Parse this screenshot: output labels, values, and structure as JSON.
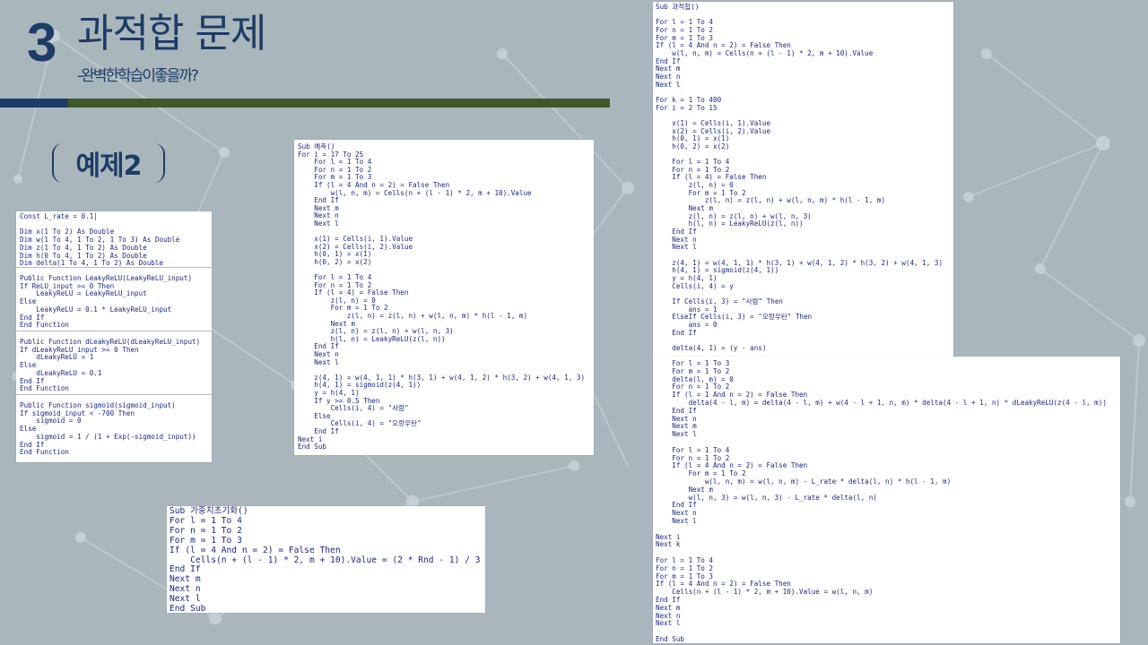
{
  "header": {
    "number": "3",
    "title": "과적합 문제",
    "subtitle": "-완벽한학습이좋을까?"
  },
  "example_label": "예제2",
  "colors": {
    "title_navy": "#1d3c66",
    "rule_green": "#3d5a2a",
    "code_text": "#1a2a7a",
    "background": "#a9b7bd"
  },
  "code": {
    "declarations": "Const L_rate = 0.1|\n\nDim x(1 To 2) As Double\nDim w(1 To 4, 1 To 2, 1 To 3) As Double\nDim z(1 To 4, 1 To 2) As Double\nDim h(0 To 4, 1 To 2) As Double\nDim delta(1 To 4, 1 To 2) As Double",
    "leaky_relu": "Public Function LeakyReLU(LeakyReLU_input)\nIf ReLU_input >= 0 Then\n    LeakyReLU = LeakyReLU_input\nElse\n    LeakyReLU = 0.1 * LeakyReLU_input\nEnd If\nEnd Function",
    "d_leaky_relu": "Public Function dLeakyReLU(dLeakyReLU_input)\nIf dLeakyReLU_input >= 0 Then\n    dLeakyReLU = 1\nElse\n    dLeakyReLU = 0.1\nEnd If\nEnd Function",
    "sigmoid": "Public Function sigmoid(sigmoid_input)\nIf sigmoid_input < -700 Then\n    sigmoid = 0\nElse\n    sigmoid = 1 / (1 + Exp(-sigmoid_input))\nEnd If\nEnd Function",
    "predict": "Sub 예측()\nFor i = 17 To 25\n    For l = 1 To 4\n    For n = 1 To 2\n    For m = 1 To 3\n    If (l = 4 And n = 2) = False Then\n        w(l, n, m) = Cells(n + (l - 1) * 2, m + 10).Value\n    End If\n    Next m\n    Next n\n    Next l\n\n    x(1) = Cells(i, 1).Value\n    x(2) = Cells(i, 2).Value\n    h(0, 1) = x(1)\n    h(0, 2) = x(2)\n\n    For l = 1 To 4\n    For n = 1 To 2\n    If (l = 4) = False Then\n        z(l, n) = 0\n        For m = 1 To 2\n            z(l, n) = z(l, n) + w(l, n, m) * h(l - 1, m)\n        Next m\n        z(l, n) = z(l, n) + w(l, n, 3)\n        h(l, n) = LeakyReLU(z(l, n))\n    End If\n    Next n\n    Next l\n\n    z(4, 1) = w(4, 1, 1) * h(3, 1) + w(4, 1, 2) * h(3, 2) + w(4, 1, 3)\n    h(4, 1) = sigmoid(z(4, 1))\n    y = h(4, 1)\n    If y >= 0.5 Then\n        Cells(i, 4) = \"사람\"\n    Else\n        Cells(i, 4) = \"오랑우탄\"\n    End If\nNext i\nEnd Sub",
    "init_weights": "Sub 가중치초기화()\nFor l = 1 To 4\nFor n = 1 To 2\nFor m = 1 To 3\nIf (l = 4 And n = 2) = False Then\n    Cells(n + (l - 1) * 2, m + 10).Value = (2 * Rnd - 1) / 3\nEnd If\nNext m\nNext n\nNext l\nEnd Sub",
    "overfit_top": "Sub 과적합()\n\nFor l = 1 To 4\nFor n = 1 To 2\nFor m = 1 To 3\nIf (l = 4 And n = 2) = False Then\n    w(l, n, m) = Cells(n + (l - 1) * 2, m + 10).Value\nEnd If\nNext m\nNext n\nNext l\n\nFor k = 1 To 400\nFor i = 2 To 15\n\n    x(1) = Cells(i, 1).Value\n    x(2) = Cells(i, 2).Value\n    h(0, 1) = x(1)\n    h(0, 2) = x(2)\n\n    For l = 1 To 4\n    For n = 1 To 2\n    If (l = 4) = False Then\n        z(l, n) = 0\n        For m = 1 To 2\n            z(l, n) = z(l, n) + w(l, n, m) * h(l - 1, m)\n        Next m\n        z(l, n) = z(l, n) + w(l, n, 3)\n        h(l, n) = LeakyReLU(z(l, n))\n    End If\n    Next n\n    Next l\n\n    z(4, 1) = w(4, 1, 1) * h(3, 1) + w(4, 1, 2) * h(3, 2) + w(4, 1, 3)\n    h(4, 1) = sigmoid(z(4, 1))\n    y = h(4, 1)\n    Cells(i, 4) = y\n\n    If Cells(i, 3) = \"사람\" Then\n        ans = 1\n    ElseIf Cells(i, 3) = \"오랑우탄\" Then\n        ans = 0\n    End If\n\n    delta(4, 1) = (y - ans)",
    "overfit_bottom": "    For l = 1 To 3\n    For m = 1 To 2\n    delta(l, m) = 0\n    For n = 1 To 2\n    If (l = 1 And n = 2) = False Then\n        delta(4 - l, m) = delta(4 - l, m) + w(4 - l + 1, n, m) * delta(4 - l + 1, n) * dLeakyReLU(z(4 - l, m))\n    End If\n    Next n\n    Next m\n    Next l\n\n    For l = 1 To 4\n    For n = 1 To 2\n    If (l = 4 And n = 2) = False Then\n        For m = 1 To 2\n            w(l, n, m) = w(l, n, m) - L_rate * delta(l, n) * h(l - 1, m)\n        Next m\n        w(l, n, 3) = w(l, n, 3) - L_rate * delta(l, n)\n    End If\n    Next n\n    Next l\n\nNext i\nNext k\n\nFor l = 1 To 4\nFor n = 1 To 2\nFor m = 1 To 3\nIf (l = 4 And n = 2) = False Then\n    Cells(n + (l - 1) * 2, m + 10).Value = w(l, n, m)\nEnd If\nNext m\nNext n\nNext l\n\nEnd Sub"
  }
}
